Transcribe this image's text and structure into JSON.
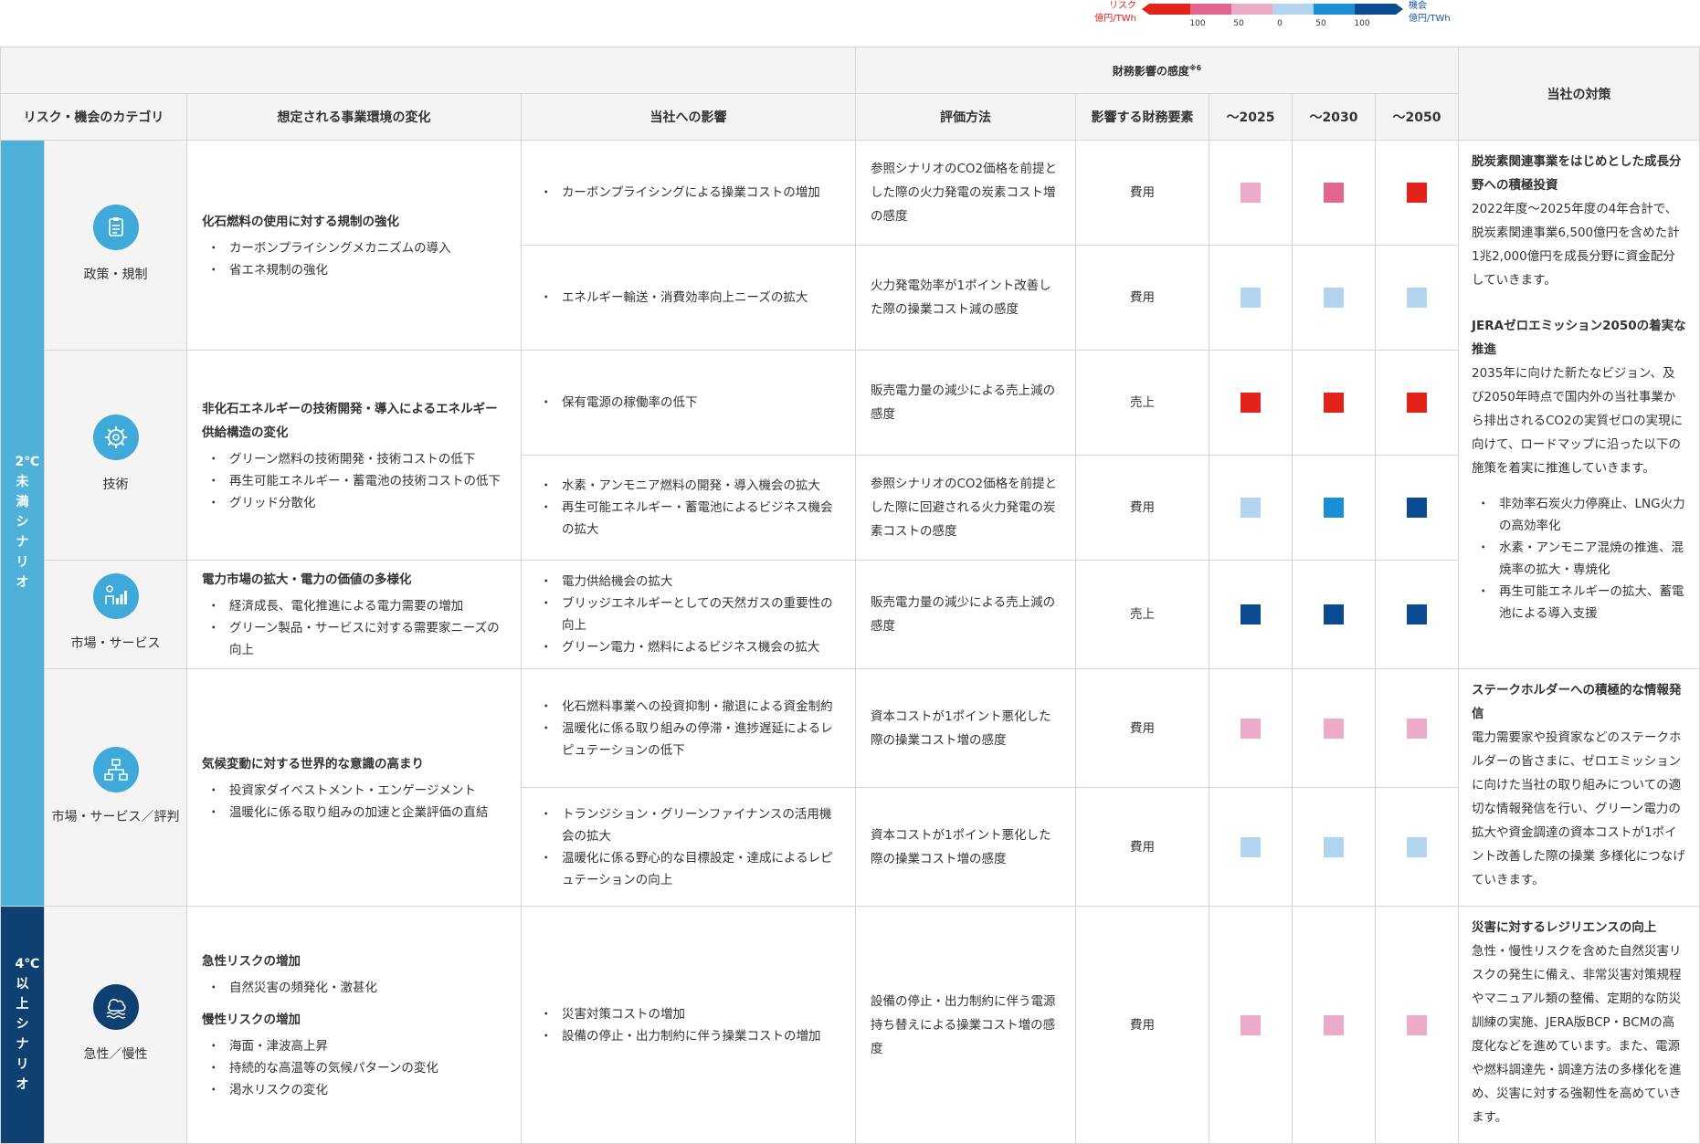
{
  "legend": {
    "risk_label": [
      "リスク",
      "億円/TWh"
    ],
    "opportunity_label": [
      "機会",
      "億円/TWh"
    ],
    "ticks": [
      "100",
      "50",
      "0",
      "50",
      "100"
    ],
    "colors": [
      "#e2231a",
      "#e2668f",
      "#ecabc9",
      "#b3d4ef",
      "#1b8fd6",
      "#0b4b91"
    ]
  },
  "header": {
    "financial_impact": "財務影響の感度",
    "financial_impact_note": "※6",
    "category": "リスク・機会のカテゴリ",
    "change": "想定される事業環境の変化",
    "impact": "当社への影響",
    "method": "評価方法",
    "element": "影響する財務要素",
    "y2025": "～2025",
    "y2030": "～2030",
    "y2050": "～2050",
    "policy": "当社の対策"
  },
  "scenarios": {
    "s2": "2℃未満シナリオ",
    "s4": "4℃以上シナリオ"
  },
  "categories": {
    "policy": "政策・規制",
    "tech": "技術",
    "market": "市場・サービス",
    "reputation": "市場・サービス／評判",
    "acute": "急性／慢性"
  },
  "changes": {
    "c1": {
      "title": "化石燃料の使用に対する規制の強化",
      "items": [
        "カーボンプライシングメカニズムの導入",
        "省エネ規制の強化"
      ]
    },
    "c2": {
      "title": "非化石エネルギーの技術開発・導入によるエネルギー供給構造の変化",
      "items": [
        "グリーン燃料の技術開発・技術コストの低下",
        "再生可能エネルギー・蓄電池の技術コストの低下",
        "グリッド分散化"
      ]
    },
    "c3": {
      "title": "電力市場の拡大・電力の価値の多様化",
      "items": [
        "経済成長、電化推進による電力需要の増加",
        "グリーン製品・サービスに対する需要家ニーズの向上"
      ]
    },
    "c4": {
      "title": "気候変動に対する世界的な意識の高まり",
      "items": [
        "投資家ダイベストメント・エンゲージメント",
        "温暖化に係る取り組みの加速と企業評価の直結"
      ]
    },
    "c5": {
      "title1": "急性リスクの増加",
      "items1": [
        "自然災害の頻発化・激甚化"
      ],
      "title2": "慢性リスクの増加",
      "items2": [
        "海面・津波高上昇",
        "持続的な高温等の気候パターンの変化",
        "渇水リスクの変化"
      ]
    }
  },
  "rows": [
    {
      "impact": [
        "カーボンプライシングによる操業コストの増加"
      ],
      "method": "参照シナリオのCO2価格を前提とした際の火力発電の炭素コスト増の感度",
      "element": "費用",
      "levels": [
        "#ecabc9",
        "#e2668f",
        "#e2231a"
      ]
    },
    {
      "impact": [
        "エネルギー輸送・消費効率向上ニーズの拡大"
      ],
      "method": "火力発電効率が1ポイント改善した際の操業コスト減の感度",
      "element": "費用",
      "levels": [
        "#b3d4ef",
        "#b3d4ef",
        "#b3d4ef"
      ]
    },
    {
      "impact": [
        "保有電源の稼働率の低下"
      ],
      "method": "販売電力量の減少による売上減の感度",
      "element": "売上",
      "levels": [
        "#e2231a",
        "#e2231a",
        "#e2231a"
      ]
    },
    {
      "impact": [
        "水素・アンモニア燃料の開発・導入機会の拡大",
        "再生可能エネルギー・蓄電池によるビジネス機会の拡大"
      ],
      "method": "参照シナリオのCO2価格を前提とした際に回避される火力発電の炭素コストの感度",
      "element": "費用",
      "levels": [
        "#b3d4ef",
        "#1b8fd6",
        "#0b4b91"
      ]
    },
    {
      "impact": [
        "電力供給機会の拡大",
        "ブリッジエネルギーとしての天然ガスの重要性の向上",
        "グリーン電力・燃料によるビジネス機会の拡大"
      ],
      "method": "販売電力量の減少による売上減の感度",
      "element": "売上",
      "levels": [
        "#0b4b91",
        "#0b4b91",
        "#0b4b91"
      ]
    },
    {
      "impact": [
        "化石燃料事業への投資抑制・撤退による資金制約",
        "温暖化に係る取り組みの停滞・進捗遅延によるレピュテーションの低下"
      ],
      "method": "資本コストが1ポイント悪化した際の操業コスト増の感度",
      "element": "費用",
      "levels": [
        "#ecabc9",
        "#ecabc9",
        "#ecabc9"
      ]
    },
    {
      "impact": [
        "トランジション・グリーンファイナンスの活用機会の拡大",
        "温暖化に係る野心的な目標設定・達成によるレピュテーションの向上"
      ],
      "method": "資本コストが1ポイント悪化した際の操業コスト増の感度",
      "element": "費用",
      "levels": [
        "#b3d4ef",
        "#b3d4ef",
        "#b3d4ef"
      ]
    },
    {
      "impact": [
        "災害対策コストの増加",
        "設備の停止・出力制約に伴う操業コストの増加"
      ],
      "method": "設備の停止・出力制約に伴う電源持ち替えによる操業コスト増の感度",
      "element": "費用",
      "levels": [
        "#ecabc9",
        "#ecabc9",
        "#ecabc9"
      ]
    }
  ],
  "policies": {
    "p1": {
      "b1_title": "脱炭素関連事業をはじめとした成長分野への積極投資",
      "b1_text": "2022年度～2025年度の4年合計で、脱炭素関連事業6,500億円を含めた計1兆2,000億円を成長分野に資金配分していきます。",
      "b2_title": "JERAゼロエミッション2050の着実な推進",
      "b2_text": "2035年に向けた新たなビジョン、及び2050年時点で国内外の当社事業から排出されるCO2の実質ゼロの実現に向けて、ロードマップに沿った以下の施策を着実に推進していきます。",
      "items": [
        "非効率石炭火力停廃止、LNG火力の高効率化",
        "水素・アンモニア混焼の推進、混焼率の拡大・専焼化",
        "再生可能エネルギーの拡大、蓄電池による導入支援"
      ]
    },
    "p2": {
      "title": "ステークホルダーへの積極的な情報発信",
      "text": "電力需要家や投資家などのステークホルダーの皆さまに、ゼロエミッションに向けた当社の取り組みについての適切な情報発信を行い、グリーン電力の拡大や資金調達の資本コストが1ポイント改善した際の操業 多様化につなげていきます。"
    },
    "p3": {
      "title": "災害に対するレジリエンスの向上",
      "text": "急性・慢性リスクを含めた自然災害リスクの発生に備え、非常災害対策規程やマニュアル類の整備、定期的な防災訓練の実施、JERA版BCP・BCMの高度化などを進めています。また、電源や燃料調達先・調達方法の多様化を進め、災害に対する強靭性を高めていきます。"
    }
  }
}
